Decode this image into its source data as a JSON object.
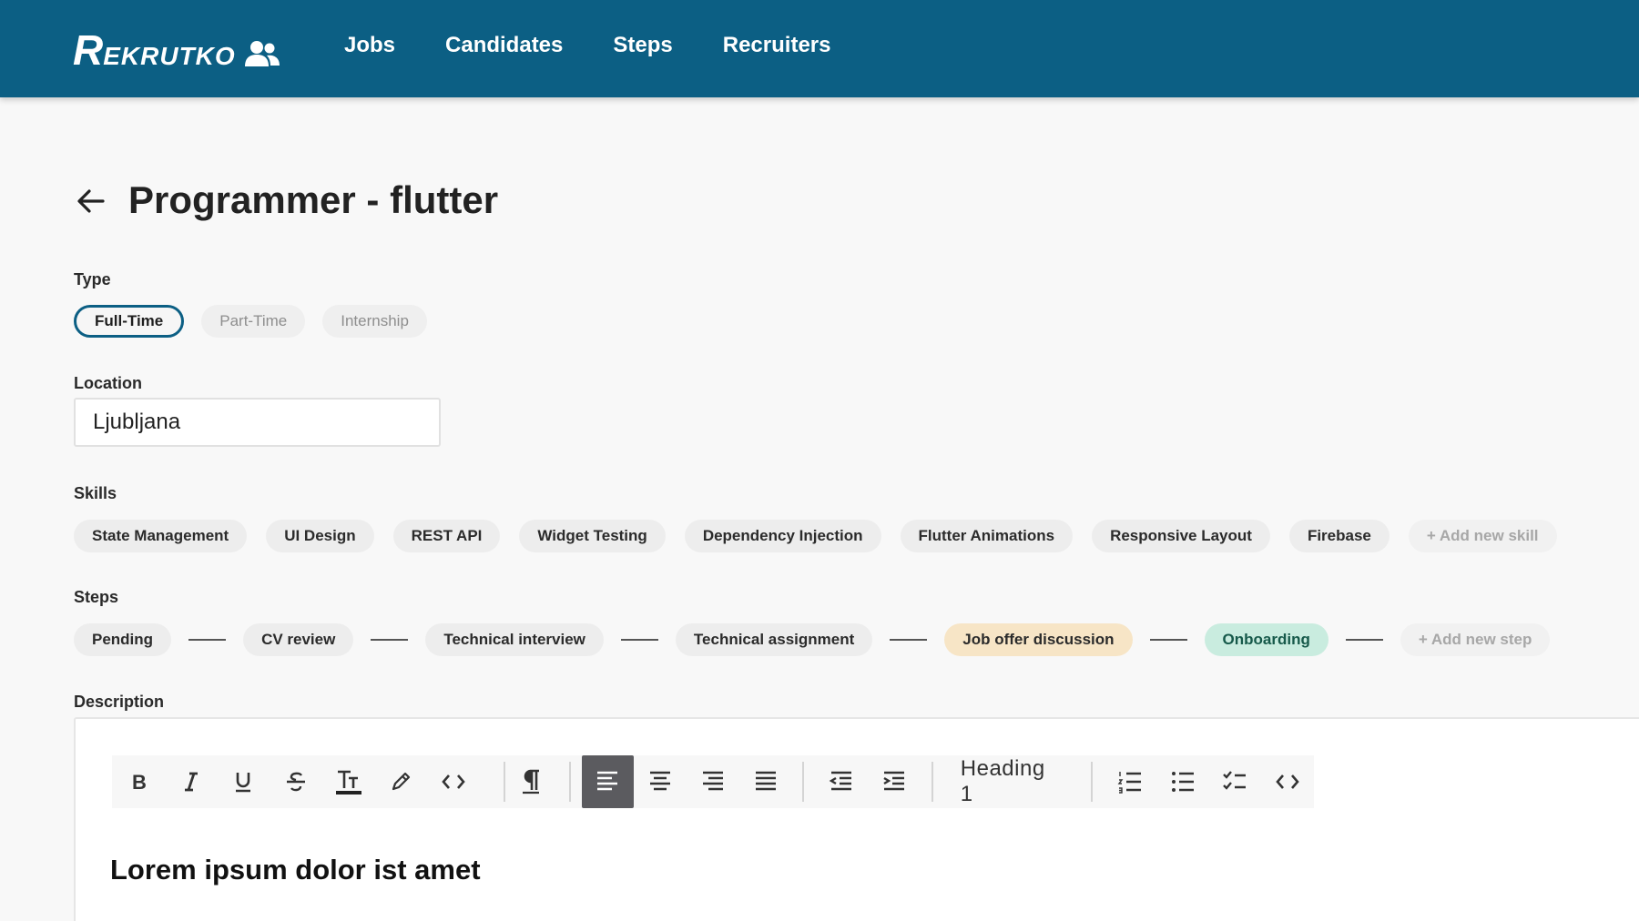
{
  "app": {
    "logo_big": "R",
    "logo_rest": "EKRUTKO",
    "nav": [
      "Jobs",
      "Candidates",
      "Steps",
      "Recruiters"
    ]
  },
  "page": {
    "title": "Programmer - flutter"
  },
  "type_section": {
    "label": "Type",
    "options": [
      "Full-Time",
      "Part-Time",
      "Internship"
    ],
    "selected": "Full-Time"
  },
  "location_section": {
    "label": "Location",
    "value": "Ljubljana"
  },
  "skills_section": {
    "label": "Skills",
    "items": [
      "State Management",
      "UI Design",
      "REST API",
      "Widget Testing",
      "Dependency Injection",
      "Flutter Animations",
      "Responsive Layout",
      "Firebase"
    ],
    "add_label": "+ Add new skill"
  },
  "steps_section": {
    "label": "Steps",
    "items": [
      "Pending",
      "CV review",
      "Technical interview",
      "Technical assignment",
      "Job offer discussion",
      "Onboarding"
    ],
    "add_label": "+ Add new step"
  },
  "description_section": {
    "label": "Description",
    "heading_select": "Heading 1",
    "content_heading": "Lorem ipsum dolor ist amet"
  },
  "colors": {
    "header": "#0c5f84",
    "selected_border": "#0c5f84",
    "offer_chip": "#f7e5c6",
    "onboarding_chip": "#c9ecdf"
  }
}
